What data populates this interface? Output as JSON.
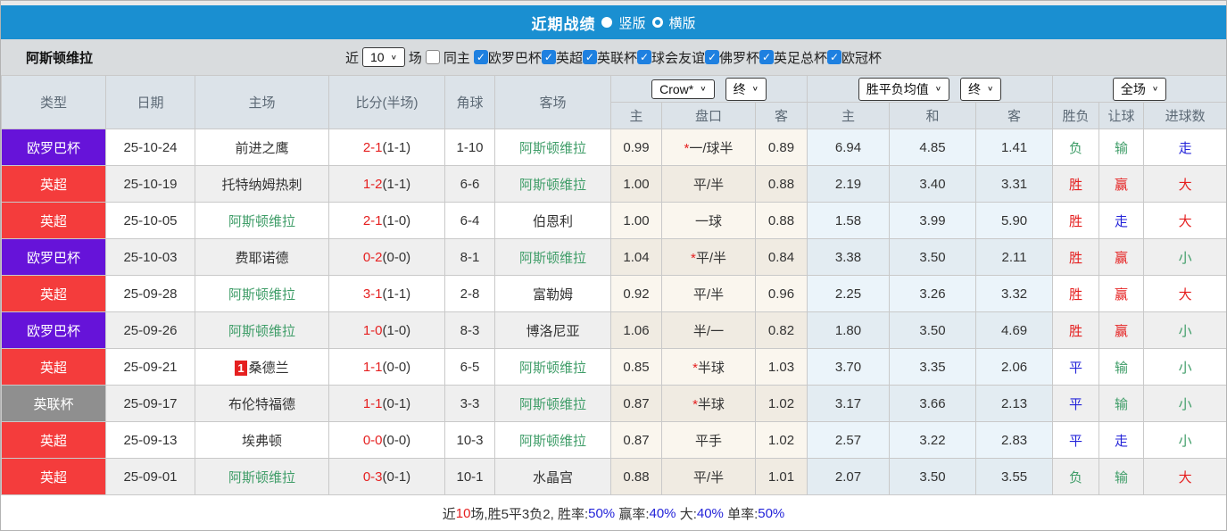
{
  "colors": {
    "titlebar_blue": "#1a8fd1",
    "checkbox_blue": "#1e80e0",
    "league_purple": "#6613d9",
    "league_red": "#f43c3c",
    "league_gray": "#8f8f8f",
    "text_red": "#e52020",
    "text_green": "#3f9d68",
    "text_blue": "#2424d9",
    "odds_col_bg": "#faf6ee",
    "avg_col_bg": "#ebf4fa",
    "header_cell_bg": "#dce3e9",
    "zebra_bg": "#efefef",
    "filter_bg": "#d9dcde"
  },
  "titlebar": {
    "title": "近期战绩",
    "radio_vertical": "竖版",
    "radio_horizontal": "横版"
  },
  "filter": {
    "team": "阿斯顿维拉",
    "near_label": "近",
    "count_value": "10",
    "games_label": "场",
    "same_home_label": "同主",
    "leagues": [
      "欧罗巴杯",
      "英超",
      "英联杯",
      "球会友谊",
      "佛罗杯",
      "英足总杯",
      "欧冠杯"
    ]
  },
  "table": {
    "headers_left": [
      "类型",
      "日期",
      "主场",
      "比分(半场)",
      "角球",
      "客场"
    ],
    "dropdowns": {
      "odds_company": "Crow*",
      "odds_stage": "终",
      "avg_label": "胜平负均值",
      "avg_stage": "终",
      "scope": "全场"
    },
    "subheaders": [
      "主",
      "盘口",
      "客",
      "主",
      "和",
      "客",
      "胜负",
      "让球",
      "进球数"
    ],
    "rows": [
      {
        "league": "欧罗巴杯",
        "league_color": "purple",
        "date": "25-10-24",
        "home": "前进之鹰",
        "home_villa": false,
        "home_rank": "",
        "score": "2-1",
        "half": "(1-1)",
        "corner": "1-10",
        "away": "阿斯顿维拉",
        "away_villa": true,
        "odds_home": "0.99",
        "handicap_star": "*",
        "handicap": "一/球半",
        "odds_away": "0.89",
        "avg_home": "6.94",
        "avg_draw": "4.85",
        "avg_away": "1.41",
        "result": "负",
        "result_color": "green",
        "let_result": "输",
        "let_color": "green",
        "goal_result": "走",
        "goal_color": "blue"
      },
      {
        "league": "英超",
        "league_color": "red",
        "date": "25-10-19",
        "home": "托特纳姆热刺",
        "home_villa": false,
        "home_rank": "",
        "score": "1-2",
        "half": "(1-1)",
        "corner": "6-6",
        "away": "阿斯顿维拉",
        "away_villa": true,
        "odds_home": "1.00",
        "handicap_star": "",
        "handicap": "平/半",
        "odds_away": "0.88",
        "avg_home": "2.19",
        "avg_draw": "3.40",
        "avg_away": "3.31",
        "result": "胜",
        "result_color": "red",
        "let_result": "赢",
        "let_color": "red",
        "goal_result": "大",
        "goal_color": "red"
      },
      {
        "league": "英超",
        "league_color": "red",
        "date": "25-10-05",
        "home": "阿斯顿维拉",
        "home_villa": true,
        "home_rank": "",
        "score": "2-1",
        "half": "(1-0)",
        "corner": "6-4",
        "away": "伯恩利",
        "away_villa": false,
        "odds_home": "1.00",
        "handicap_star": "",
        "handicap": "一球",
        "odds_away": "0.88",
        "avg_home": "1.58",
        "avg_draw": "3.99",
        "avg_away": "5.90",
        "result": "胜",
        "result_color": "red",
        "let_result": "走",
        "let_color": "blue",
        "goal_result": "大",
        "goal_color": "red"
      },
      {
        "league": "欧罗巴杯",
        "league_color": "purple",
        "date": "25-10-03",
        "home": "费耶诺德",
        "home_villa": false,
        "home_rank": "",
        "score": "0-2",
        "half": "(0-0)",
        "corner": "8-1",
        "away": "阿斯顿维拉",
        "away_villa": true,
        "odds_home": "1.04",
        "handicap_star": "*",
        "handicap": "平/半",
        "odds_away": "0.84",
        "avg_home": "3.38",
        "avg_draw": "3.50",
        "avg_away": "2.11",
        "result": "胜",
        "result_color": "red",
        "let_result": "赢",
        "let_color": "red",
        "goal_result": "小",
        "goal_color": "green"
      },
      {
        "league": "英超",
        "league_color": "red",
        "date": "25-09-28",
        "home": "阿斯顿维拉",
        "home_villa": true,
        "home_rank": "",
        "score": "3-1",
        "half": "(1-1)",
        "corner": "2-8",
        "away": "富勒姆",
        "away_villa": false,
        "odds_home": "0.92",
        "handicap_star": "",
        "handicap": "平/半",
        "odds_away": "0.96",
        "avg_home": "2.25",
        "avg_draw": "3.26",
        "avg_away": "3.32",
        "result": "胜",
        "result_color": "red",
        "let_result": "赢",
        "let_color": "red",
        "goal_result": "大",
        "goal_color": "red"
      },
      {
        "league": "欧罗巴杯",
        "league_color": "purple",
        "date": "25-09-26",
        "home": "阿斯顿维拉",
        "home_villa": true,
        "home_rank": "",
        "score": "1-0",
        "half": "(1-0)",
        "corner": "8-3",
        "away": "博洛尼亚",
        "away_villa": false,
        "odds_home": "1.06",
        "handicap_star": "",
        "handicap": "半/一",
        "odds_away": "0.82",
        "avg_home": "1.80",
        "avg_draw": "3.50",
        "avg_away": "4.69",
        "result": "胜",
        "result_color": "red",
        "let_result": "赢",
        "let_color": "red",
        "goal_result": "小",
        "goal_color": "green"
      },
      {
        "league": "英超",
        "league_color": "red",
        "date": "25-09-21",
        "home": "桑德兰",
        "home_villa": false,
        "home_rank": "1",
        "score": "1-1",
        "half": "(0-0)",
        "corner": "6-5",
        "away": "阿斯顿维拉",
        "away_villa": true,
        "odds_home": "0.85",
        "handicap_star": "*",
        "handicap": "半球",
        "odds_away": "1.03",
        "avg_home": "3.70",
        "avg_draw": "3.35",
        "avg_away": "2.06",
        "result": "平",
        "result_color": "blue",
        "let_result": "输",
        "let_color": "green",
        "goal_result": "小",
        "goal_color": "green"
      },
      {
        "league": "英联杯",
        "league_color": "gray",
        "date": "25-09-17",
        "home": "布伦特福德",
        "home_villa": false,
        "home_rank": "",
        "score": "1-1",
        "half": "(0-1)",
        "corner": "3-3",
        "away": "阿斯顿维拉",
        "away_villa": true,
        "odds_home": "0.87",
        "handicap_star": "*",
        "handicap": "半球",
        "odds_away": "1.02",
        "avg_home": "3.17",
        "avg_draw": "3.66",
        "avg_away": "2.13",
        "result": "平",
        "result_color": "blue",
        "let_result": "输",
        "let_color": "green",
        "goal_result": "小",
        "goal_color": "green"
      },
      {
        "league": "英超",
        "league_color": "red",
        "date": "25-09-13",
        "home": "埃弗顿",
        "home_villa": false,
        "home_rank": "",
        "score": "0-0",
        "half": "(0-0)",
        "corner": "10-3",
        "away": "阿斯顿维拉",
        "away_villa": true,
        "odds_home": "0.87",
        "handicap_star": "",
        "handicap": "平手",
        "odds_away": "1.02",
        "avg_home": "2.57",
        "avg_draw": "3.22",
        "avg_away": "2.83",
        "result": "平",
        "result_color": "blue",
        "let_result": "走",
        "let_color": "blue",
        "goal_result": "小",
        "goal_color": "green"
      },
      {
        "league": "英超",
        "league_color": "red",
        "date": "25-09-01",
        "home": "阿斯顿维拉",
        "home_villa": true,
        "home_rank": "",
        "score": "0-3",
        "half": "(0-1)",
        "corner": "10-1",
        "away": "水晶宫",
        "away_villa": false,
        "odds_home": "0.88",
        "handicap_star": "",
        "handicap": "平/半",
        "odds_away": "1.01",
        "avg_home": "2.07",
        "avg_draw": "3.50",
        "avg_away": "3.55",
        "result": "负",
        "result_color": "green",
        "let_result": "输",
        "let_color": "green",
        "goal_result": "大",
        "goal_color": "red"
      }
    ]
  },
  "footer": {
    "segments": [
      {
        "t": "近",
        "c": "dark"
      },
      {
        "t": "10",
        "c": "red"
      },
      {
        "t": "场,胜5平3负2, 胜率:",
        "c": "dark"
      },
      {
        "t": "50%",
        "c": "blue"
      },
      {
        "t": " 赢率:",
        "c": "dark"
      },
      {
        "t": "40%",
        "c": "blue"
      },
      {
        "t": " 大:",
        "c": "dark"
      },
      {
        "t": "40%",
        "c": "blue"
      },
      {
        "t": " 单率:",
        "c": "dark"
      },
      {
        "t": "50%",
        "c": "blue"
      }
    ]
  }
}
